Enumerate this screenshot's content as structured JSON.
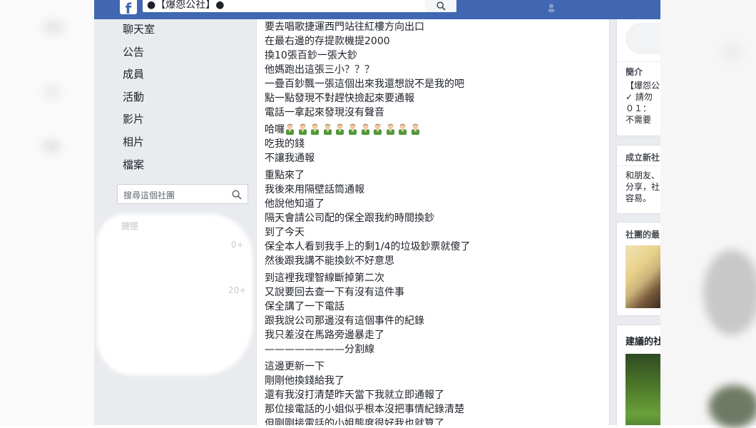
{
  "topbar": {
    "logo": "f",
    "search_value": "●【爆怨公社】●",
    "search_icon": "search-icon"
  },
  "left_nav": {
    "items": [
      {
        "label": "聊天室"
      },
      {
        "label": "公告"
      },
      {
        "label": "成員"
      },
      {
        "label": "活動"
      },
      {
        "label": "影片"
      },
      {
        "label": "相片"
      },
      {
        "label": "檔案"
      }
    ],
    "group_search_placeholder": "搜尋這個社團",
    "shortcuts_label": "捷徑",
    "count_1": "0+",
    "count_2": "20+"
  },
  "post": {
    "blocks": [
      [
        "要去唱歌捷運西門站往紅樓方向出口",
        "在最右邊的存提款機提2000",
        "換10張百鈔一張大鈔",
        "他媽跑出這張三小？？？",
        "一疊百鈔飄一張這個出來我還想說不是我的吧",
        "點一點發現不對趕快撿起來要通報",
        "電話一拿起來發現沒有聲音"
      ],
      [
        "哈囉",
        "吃我的錢",
        "不讓我通報"
      ],
      [
        "重點來了",
        "我後來用隔壁話筒通報",
        "他說他知道了",
        "隔天會請公司配的保全跟我約時間換鈔",
        "到了今天",
        "保全本人看到我手上的剩1/4的垃圾鈔票就傻了",
        "然後跟我講不能換鈥不好意思"
      ],
      [
        "到這裡我理智線斷掉第二次",
        "又說要回去查一下有沒有這件事",
        "保全講了一下電話",
        "跟我說公司那邊沒有這個事件的紀錄",
        "我只差沒在馬路旁邊暴走了",
        "————————分割線"
      ],
      [
        "這邊更新一下",
        "剛剛他換錢給我了",
        "還有我沒打清楚昨天當下我就立即通報了",
        "那位接電話的小姐似乎根本沒把事情紀錄清楚",
        "但剛剛接電話的小姐態度很好我也就算了"
      ]
    ],
    "emoji_count": 11
  },
  "right_col": {
    "intro_title": "簡介",
    "intro_lines": [
      "【爆怨公",
      "✓ 請勿",
      "０１：",
      "不需要"
    ],
    "create_title": "成立新社",
    "create_lines": [
      "和朋友、",
      "分享，社",
      "容易。"
    ],
    "recent_title": "社團的最",
    "suggest_title": "建議的社"
  },
  "colors": {
    "topbar": "#4267b2",
    "background": "#e9ebee",
    "text": "#1d2129"
  }
}
